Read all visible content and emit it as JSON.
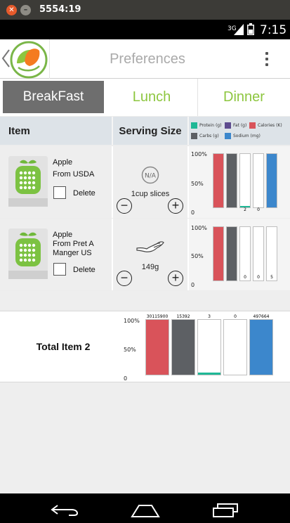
{
  "window": {
    "title": "5554:19",
    "close_glyph": "✕",
    "minimize_glyph": "–"
  },
  "status_bar": {
    "network": "3G",
    "time": "7:15"
  },
  "action_bar": {
    "title": "Preferences"
  },
  "tabs": [
    {
      "label": "BreakFast",
      "selected": true
    },
    {
      "label": "Lunch",
      "selected": false
    },
    {
      "label": "Dinner",
      "selected": false
    }
  ],
  "table_header": {
    "item": "Item",
    "serving_size": "Serving Size"
  },
  "legend": [
    {
      "label": "Protein (g)",
      "color": "#1fb896"
    },
    {
      "label": "Fat (g)",
      "color": "#5e4c8f"
    },
    {
      "label": "Calories (K)",
      "color": "#d9535a"
    },
    {
      "label": "Carbs (g)",
      "color": "#5d6064"
    },
    {
      "label": "Sodium (mg)",
      "color": "#3c87cc"
    }
  ],
  "axis_ticks": [
    "100%",
    "50%",
    "0"
  ],
  "items": [
    {
      "name": "Apple",
      "source": "From USDA",
      "delete_label": "Delete",
      "serving_badge": "N/A",
      "serving": "1cup slices",
      "bars": [
        {
          "level": 1.0,
          "color": "#d9535a",
          "label": ""
        },
        {
          "level": 1.0,
          "color": "#5d6064",
          "label": ""
        },
        {
          "level": 0.03,
          "color": "#1fb896",
          "label": "2"
        },
        {
          "level": 0.0,
          "color": "#5e4c8f",
          "label": "0"
        },
        {
          "level": 1.0,
          "color": "#3c87cc",
          "label": ""
        }
      ]
    },
    {
      "name": "Apple",
      "source": "From Pret A Manger US",
      "delete_label": "Delete",
      "serving": "149g",
      "bars": [
        {
          "level": 1.0,
          "color": "#d9535a",
          "label": ""
        },
        {
          "level": 1.0,
          "color": "#5d6064",
          "label": ""
        },
        {
          "level": 0.0,
          "color": "#1fb896",
          "label": "0"
        },
        {
          "level": 0.0,
          "color": "#5e4c8f",
          "label": "0"
        },
        {
          "level": 0.0,
          "color": "#3c87cc",
          "label": "5"
        }
      ]
    }
  ],
  "total": {
    "label": "Total Item",
    "count": "2",
    "bars": [
      {
        "level": 1.0,
        "color": "#d9535a",
        "label": "30115900"
      },
      {
        "level": 1.0,
        "color": "#5d6064",
        "label": "15392"
      },
      {
        "level": 0.04,
        "color": "#1fb896",
        "label": "3"
      },
      {
        "level": 0.0,
        "color": "#5e4c8f",
        "label": "0"
      },
      {
        "level": 1.0,
        "color": "#3c87cc",
        "label": "497664"
      }
    ]
  }
}
